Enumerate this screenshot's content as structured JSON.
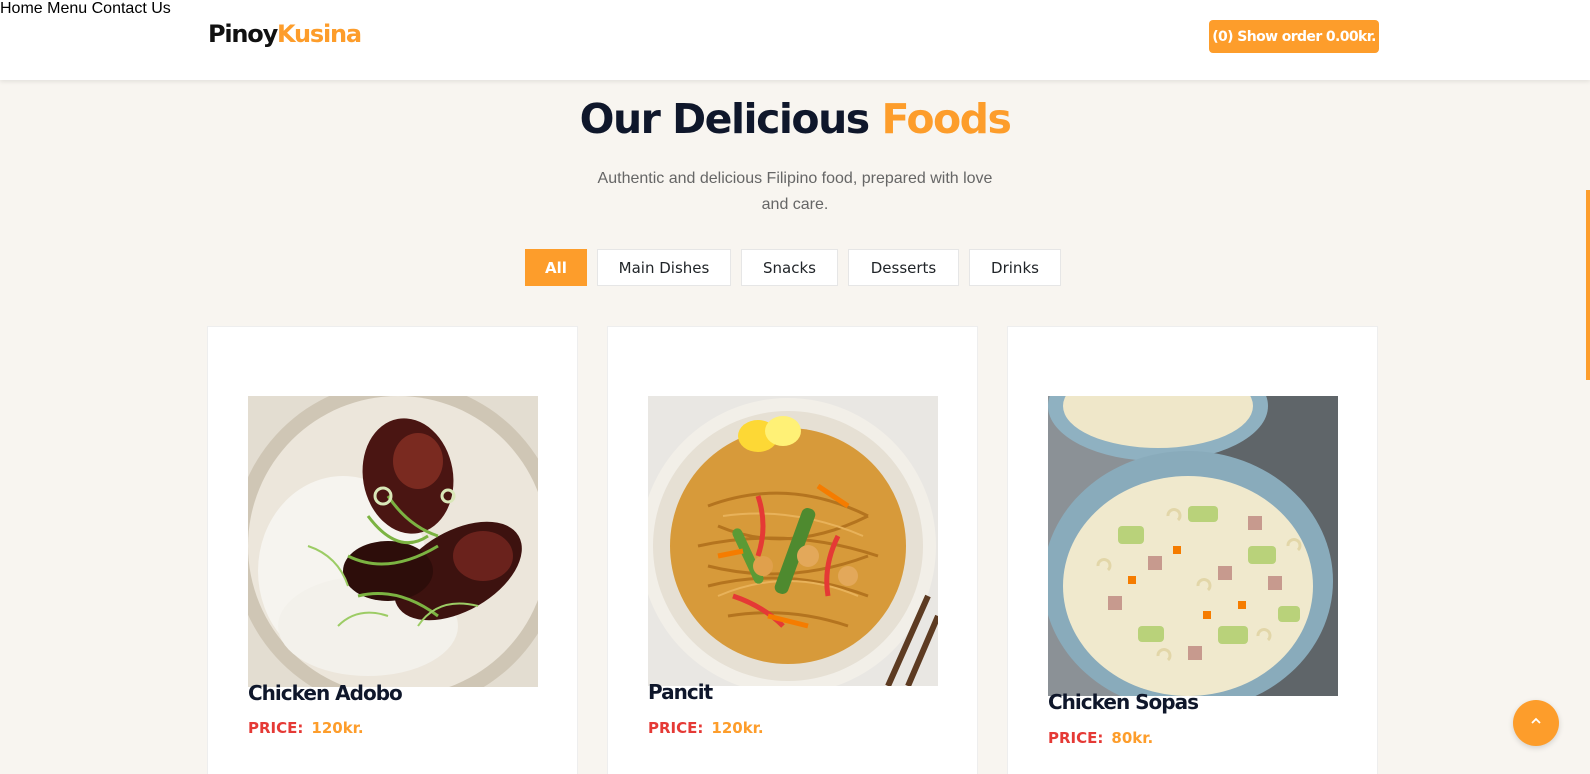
{
  "header": {
    "logo_part1": "Pinoy",
    "logo_part2": "Kusina",
    "nav": [
      "Home",
      "Menu",
      "Contact Us"
    ],
    "order_button": "(0) Show order 0.00kr."
  },
  "hero": {
    "title_part1": "Our Delicious ",
    "title_part2": "Foods",
    "subtitle": "Authentic and delicious Filipino food, prepared with love and care."
  },
  "filters": [
    {
      "label": "All",
      "active": true
    },
    {
      "label": "Main Dishes",
      "active": false
    },
    {
      "label": "Snacks",
      "active": false
    },
    {
      "label": "Desserts",
      "active": false
    },
    {
      "label": "Drinks",
      "active": false
    }
  ],
  "price_label": "PRICE:",
  "foods": [
    {
      "name": "Chicken Adobo",
      "price": "120kr."
    },
    {
      "name": "Pancit",
      "price": "120kr."
    },
    {
      "name": "Chicken Sopas",
      "price": "80kr."
    }
  ],
  "colors": {
    "accent": "#fd9d2b",
    "price_label": "#e53935",
    "background": "#f8f5f0"
  },
  "icons": {
    "scroll_top": "chevron-up-icon"
  }
}
